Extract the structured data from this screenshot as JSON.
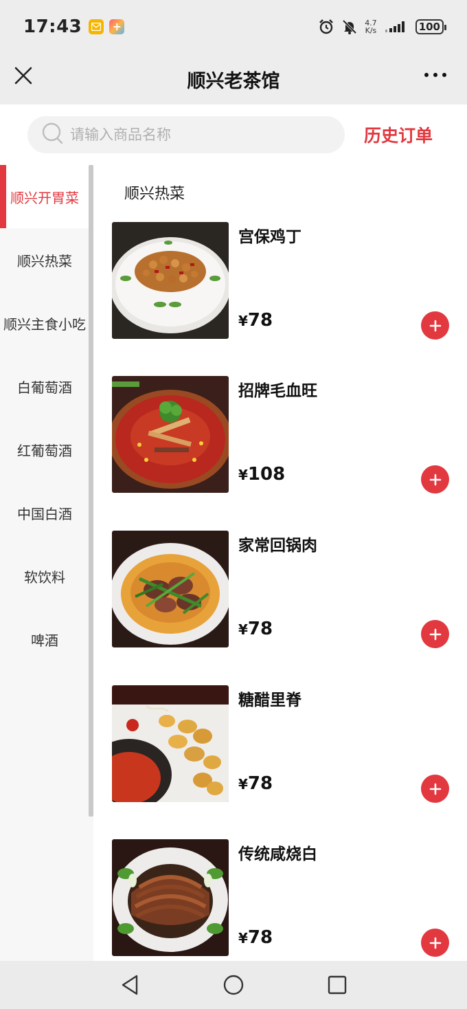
{
  "status_bar": {
    "time": "17:43",
    "net_speed_value": "4.7",
    "net_speed_unit": "K/s",
    "battery": "100",
    "icons": [
      "mail-icon",
      "app-plus-icon",
      "alarm-icon",
      "mute-bell-icon",
      "signal-icon",
      "battery-icon"
    ]
  },
  "header": {
    "title": "顺兴老茶馆",
    "close_icon": "close-icon",
    "more_icon": "more-icon"
  },
  "search": {
    "placeholder": "请输入商品名称",
    "value": "",
    "history_label": "历史订单"
  },
  "sidebar": {
    "items": [
      {
        "label": "顺兴开胃菜",
        "active": true
      },
      {
        "label": "顺兴热菜",
        "active": false
      },
      {
        "label": "顺兴主食小吃",
        "active": false
      },
      {
        "label": "白葡萄酒",
        "active": false
      },
      {
        "label": "红葡萄酒",
        "active": false
      },
      {
        "label": "中国白酒",
        "active": false
      },
      {
        "label": "软饮料",
        "active": false
      },
      {
        "label": "啤酒",
        "active": false
      }
    ]
  },
  "main": {
    "section_title": "顺兴热菜",
    "currency": "¥",
    "products": [
      {
        "name": "宫保鸡丁",
        "price": "78"
      },
      {
        "name": "招牌毛血旺",
        "price": "108"
      },
      {
        "name": "家常回锅肉",
        "price": "78"
      },
      {
        "name": "糖醋里脊",
        "price": "78"
      },
      {
        "name": "传统咸烧白",
        "price": "78"
      }
    ]
  },
  "colors": {
    "accent": "#e2383f",
    "header_bg": "#ededed",
    "sidebar_bg": "#f7f7f7"
  },
  "bottom_nav": {
    "icons": [
      "back-icon",
      "home-icon",
      "recents-icon"
    ]
  }
}
